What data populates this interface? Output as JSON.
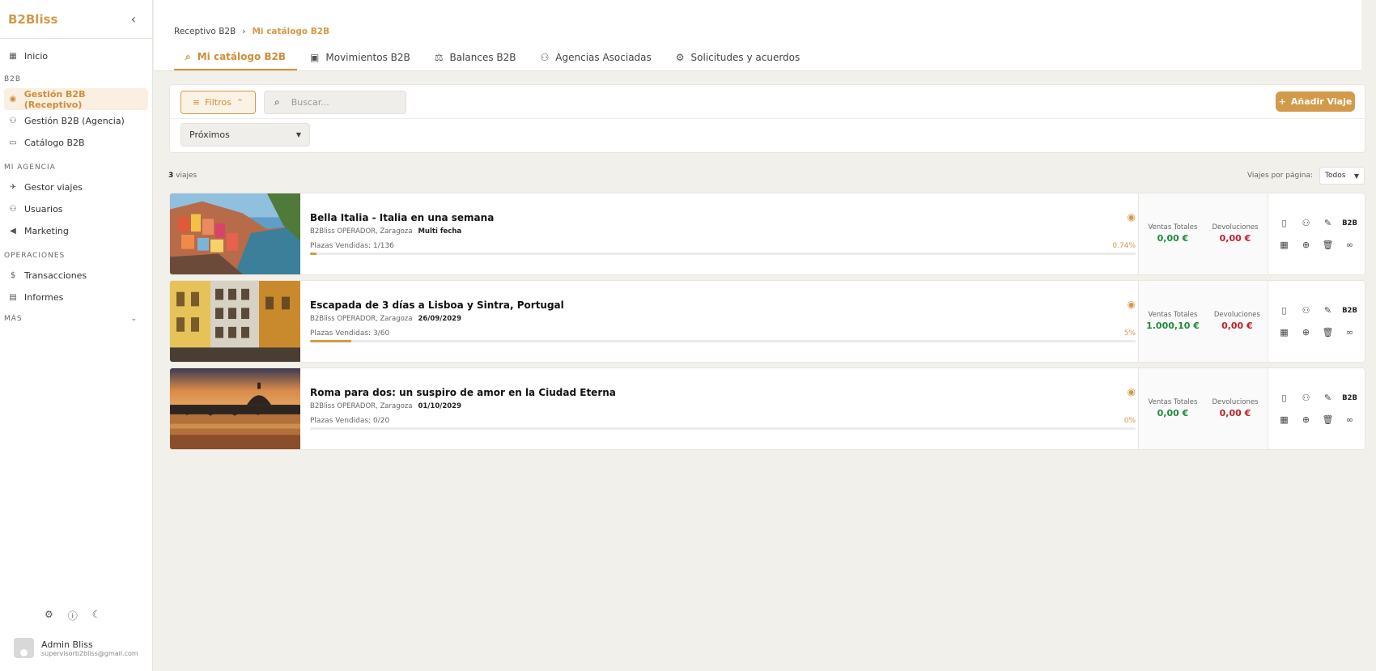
{
  "sidebar": {
    "logo": "B2Bliss",
    "collapse_icon": "‹",
    "items": [
      {
        "label": "Inicio"
      },
      {
        "section": "B2B"
      },
      {
        "label": "Gestión B2B (Receptivo)",
        "active": true
      },
      {
        "label": "Gestión B2B (Agencia)"
      },
      {
        "label": "Catálogo B2B"
      },
      {
        "section": "MI AGENCIA"
      },
      {
        "label": "Gestor viajes"
      },
      {
        "label": "Usuarios"
      },
      {
        "label": "Marketing"
      },
      {
        "section": "OPERACIONES"
      },
      {
        "label": "Transacciones"
      },
      {
        "label": "Informes"
      },
      {
        "section": "MÁS"
      }
    ],
    "nav": {
      "inicio": "Inicio",
      "section_b2b": "B2B",
      "gestion_receptivo": "Gestión B2B (Receptivo)",
      "gestion_agencia": "Gestión B2B (Agencia)",
      "catalogo": "Catálogo B2B",
      "section_agencia": "MI AGENCIA",
      "gestor_viajes": "Gestor viajes",
      "usuarios": "Usuarios",
      "marketing": "Marketing",
      "section_operaciones": "OPERACIONES",
      "transacciones": "Transacciones",
      "informes": "Informes",
      "section_mas": "MÁS"
    },
    "user": {
      "name": "Admin Bliss",
      "email": "supervisorb2bliss@gmail.com"
    }
  },
  "header": {
    "breadcrumb": {
      "parent": "Receptivo B2B",
      "separator": "›",
      "current": "Mi catálogo B2B"
    },
    "tabs": {
      "catalogo": "Mi catálogo B2B",
      "movimientos": "Movimientos B2B",
      "balances": "Balances B2B",
      "agencias": "Agencias Asociadas",
      "solicitudes": "Solicitudes y acuerdos"
    }
  },
  "filters": {
    "filter_button": "Filtros",
    "search_placeholder": "Buscar...",
    "add_button": "Añadir Viaje",
    "period_select": "Próximos"
  },
  "list": {
    "count": "3",
    "count_label": "viajes",
    "per_page_label": "Viajes por página:",
    "per_page_value": "Todos"
  },
  "trips": [
    {
      "title": "Bella Italia - Italia en una semana",
      "operator": "B2Bliss OPERADOR, Zaragoza",
      "date": "Multi fecha",
      "plazas": "Plazas Vendidas: 1/136",
      "percent_label": "0.74%",
      "progress": 0.0074,
      "ventas_label": "Ventas Totales",
      "ventas": "0,00 €",
      "devoluciones_label": "Devoluciones",
      "devoluciones": "0,00 €"
    },
    {
      "title": "Escapada de 3 días a Lisboa y Sintra, Portugal",
      "operator": "B2Bliss OPERADOR, Zaragoza",
      "date": "26/09/2029",
      "plazas": "Plazas Vendidas: 3/60",
      "percent_label": "5%",
      "progress": 0.05,
      "ventas_label": "Ventas Totales",
      "ventas": "1.000,10 €",
      "devoluciones_label": "Devoluciones",
      "devoluciones": "0,00 €"
    },
    {
      "title": "Roma para dos: un suspiro de amor en la Ciudad Eterna",
      "operator": "B2Bliss OPERADOR, Zaragoza",
      "date": "01/10/2029",
      "plazas": "Plazas Vendidas: 0/20",
      "percent_label": "0%",
      "progress": 0,
      "ventas_label": "Ventas Totales",
      "ventas": "0,00 €",
      "devoluciones_label": "Devoluciones",
      "devoluciones": "0,00 €"
    }
  ],
  "actions": {
    "b2b_label": "B2B"
  },
  "colors": {
    "accent": "#d29a4a",
    "positive": "#1e8b3b",
    "negative": "#c0202a"
  }
}
